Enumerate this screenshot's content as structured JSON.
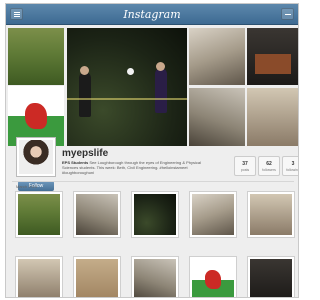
{
  "window": {
    "title": "Instagram"
  },
  "profile": {
    "username": "myepslife",
    "bio_name": "EPS Students",
    "bio_text": "See Loughborough through the eyes of Engineering & Physical Sciences students. This week: Beth, Civil Engineering. #helloinstameet #loughboroughuni",
    "follow_label": "Follow"
  },
  "stats": [
    {
      "value": "37",
      "label": "posts"
    },
    {
      "value": "62",
      "label": "followers"
    },
    {
      "value": "3",
      "label": "following"
    }
  ],
  "section": {
    "label": "March 2015"
  },
  "icons": {
    "menu": "menu-icon",
    "inbox": "inbox-icon"
  },
  "colors": {
    "topbar": "#4a7aa3",
    "follow_button": "#5a84aa",
    "frame_bg": "#eeeeee"
  }
}
